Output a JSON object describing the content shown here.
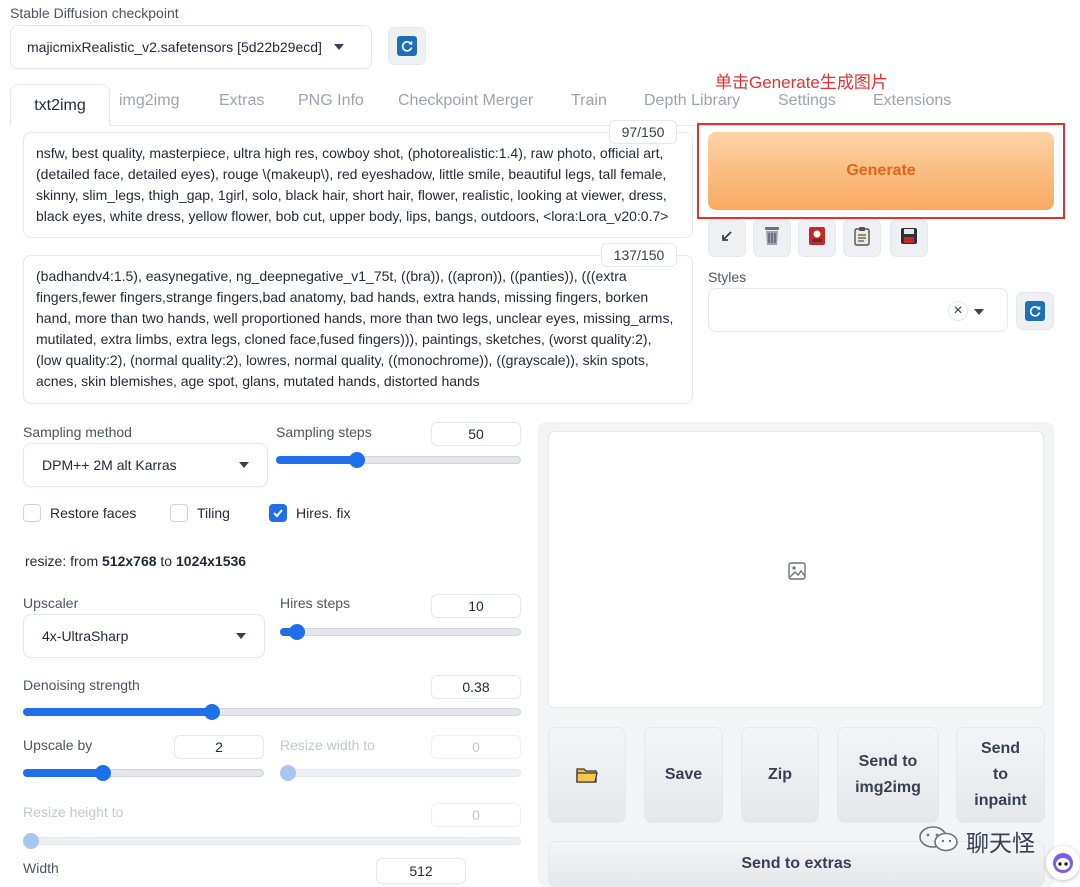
{
  "checkpoint": {
    "label": "Stable Diffusion checkpoint",
    "value": "majicmixRealistic_v2.safetensors [5d22b29ecd]"
  },
  "tabs": [
    "txt2img",
    "img2img",
    "Extras",
    "PNG Info",
    "Checkpoint Merger",
    "Train",
    "Depth Library",
    "Settings",
    "Extensions"
  ],
  "annotation": "单击Generate生成图片",
  "prompt": {
    "counter": "97/150",
    "text": "nsfw, best quality, masterpiece, ultra high res, cowboy shot, (photorealistic:1.4), raw photo, official art, (detailed face, detailed eyes), rouge \\(makeup\\), red eyeshadow, little smile, beautiful legs, tall female, skinny, slim_legs, thigh_gap, 1girl, solo, black hair, short hair, flower, realistic, looking at viewer, dress, black eyes, white dress, yellow flower, bob cut, upper body, lips, bangs, outdoors,  <lora:Lora_v20:0.7>"
  },
  "negative_prompt": {
    "counter": "137/150",
    "text": "(badhandv4:1.5), easynegative, ng_deepnegative_v1_75t, ((bra)), ((apron)), ((panties)), (((extra fingers,fewer fingers,strange fingers,bad anatomy, bad hands, extra hands, missing fingers, borken hand, more than two hands, well proportioned hands, more than two legs, unclear eyes, missing_arms, mutilated, extra limbs, extra legs, cloned face,fused fingers))), paintings, sketches, (worst quality:2), (low quality:2), (normal quality:2), lowres, normal quality, ((monochrome)), ((grayscale)), skin spots, acnes, skin blemishes, age spot, glans, mutated hands, distorted hands"
  },
  "generate_label": "Generate",
  "toolbar_icons": [
    "arrow-icon",
    "trash-icon",
    "red-card-icon",
    "clipboard-icon",
    "save-icon"
  ],
  "styles": {
    "label": "Styles",
    "clear": "×"
  },
  "sampling": {
    "method_label": "Sampling method",
    "method_value": "DPM++ 2M alt Karras",
    "steps_label": "Sampling steps",
    "steps_value": "50",
    "steps_fraction": 0.33
  },
  "checkboxes": [
    {
      "label": "Restore faces",
      "checked": false
    },
    {
      "label": "Tiling",
      "checked": false
    },
    {
      "label": "Hires. fix",
      "checked": true
    }
  ],
  "resize_info": {
    "prefix": "resize: from ",
    "from": "512x768",
    "mid": " to ",
    "to": "1024x1536"
  },
  "hires": {
    "upscaler_label": "Upscaler",
    "upscaler_value": "4x-UltraSharp",
    "steps_label": "Hires steps",
    "steps_value": "10",
    "steps_fraction": 0.07,
    "denoise_label": "Denoising strength",
    "denoise_value": "0.38",
    "denoise_fraction": 0.38,
    "upscale_label": "Upscale by",
    "upscale_value": "2",
    "upscale_fraction": 0.33,
    "resize_w_label": "Resize width to",
    "resize_w_value": "0",
    "resize_h_label": "Resize height to",
    "resize_h_value": "0"
  },
  "width": {
    "label": "Width",
    "value": "512"
  },
  "actions": {
    "folder": "folder-icon",
    "save": "Save",
    "zip": "Zip",
    "send_img2img": "Send to img2img",
    "send_inpaint": "Send to inpaint",
    "send_extras": "Send to extras"
  },
  "watermark": "聊天怪",
  "colors": {
    "accent": "#1f6feb",
    "generate_gradient_top": "#fcd3a7",
    "generate_gradient_bottom": "#f8a95f",
    "generate_text": "#e8631a",
    "annotation": "#e53030"
  }
}
